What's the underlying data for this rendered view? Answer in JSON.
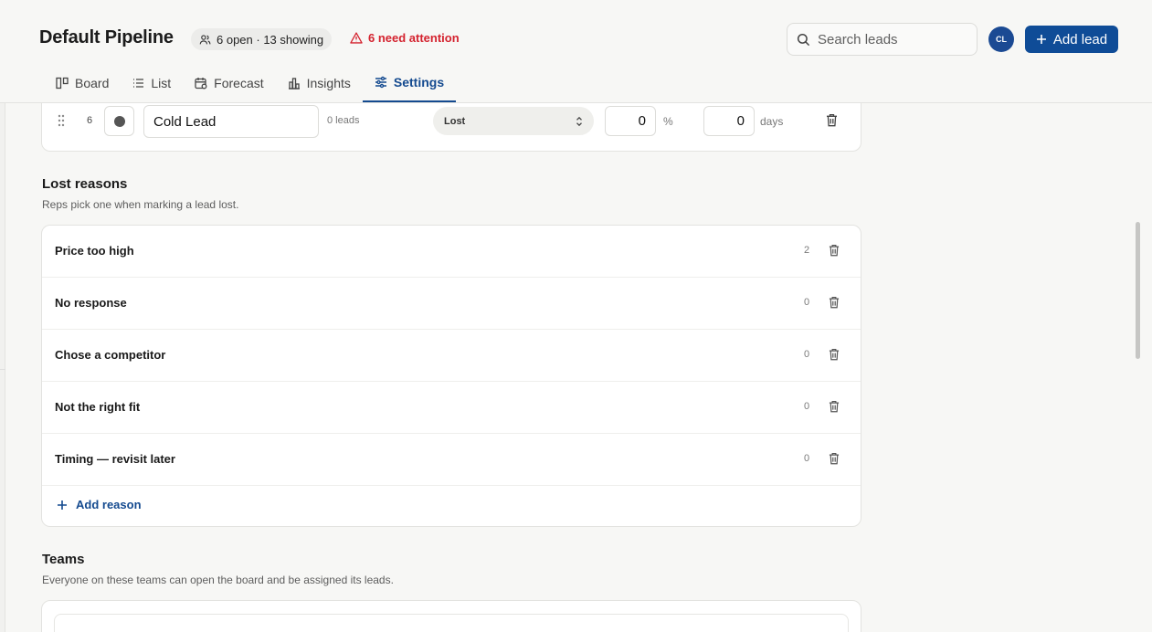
{
  "header": {
    "title": "Default Pipeline",
    "count_pill": "6 open · 13 showing",
    "attention": "6 need attention",
    "search_placeholder": "Search leads",
    "avatar_initials": "CL",
    "add_lead_label": "Add lead"
  },
  "tabs": [
    {
      "label": "Board",
      "icon": "board-icon",
      "active": false
    },
    {
      "label": "List",
      "icon": "list-icon",
      "active": false
    },
    {
      "label": "Forecast",
      "icon": "calendar-icon",
      "active": false
    },
    {
      "label": "Insights",
      "icon": "bar-chart-icon",
      "active": false
    },
    {
      "label": "Settings",
      "icon": "sliders-icon",
      "active": true
    }
  ],
  "stage": {
    "number": "6",
    "name": "Cold Lead",
    "leads": "0 leads",
    "outcome": "Lost",
    "probability": "0",
    "probability_unit": "%",
    "rot_days": "0",
    "rot_unit": "days"
  },
  "lost_reasons": {
    "title": "Lost reasons",
    "subtitle": "Reps pick one when marking a lead lost.",
    "items": [
      {
        "label": "Price too high",
        "count": "2"
      },
      {
        "label": "No response",
        "count": "0"
      },
      {
        "label": "Chose a competitor",
        "count": "0"
      },
      {
        "label": "Not the right fit",
        "count": "0"
      },
      {
        "label": "Timing — revisit later",
        "count": "0"
      }
    ],
    "add_label": "Add reason"
  },
  "teams": {
    "title": "Teams",
    "subtitle": "Everyone on these teams can open the board and be assigned its leads."
  },
  "colors": {
    "accent": "#0f4c97",
    "danger": "#d4232f",
    "background": "#f7f7f5"
  }
}
